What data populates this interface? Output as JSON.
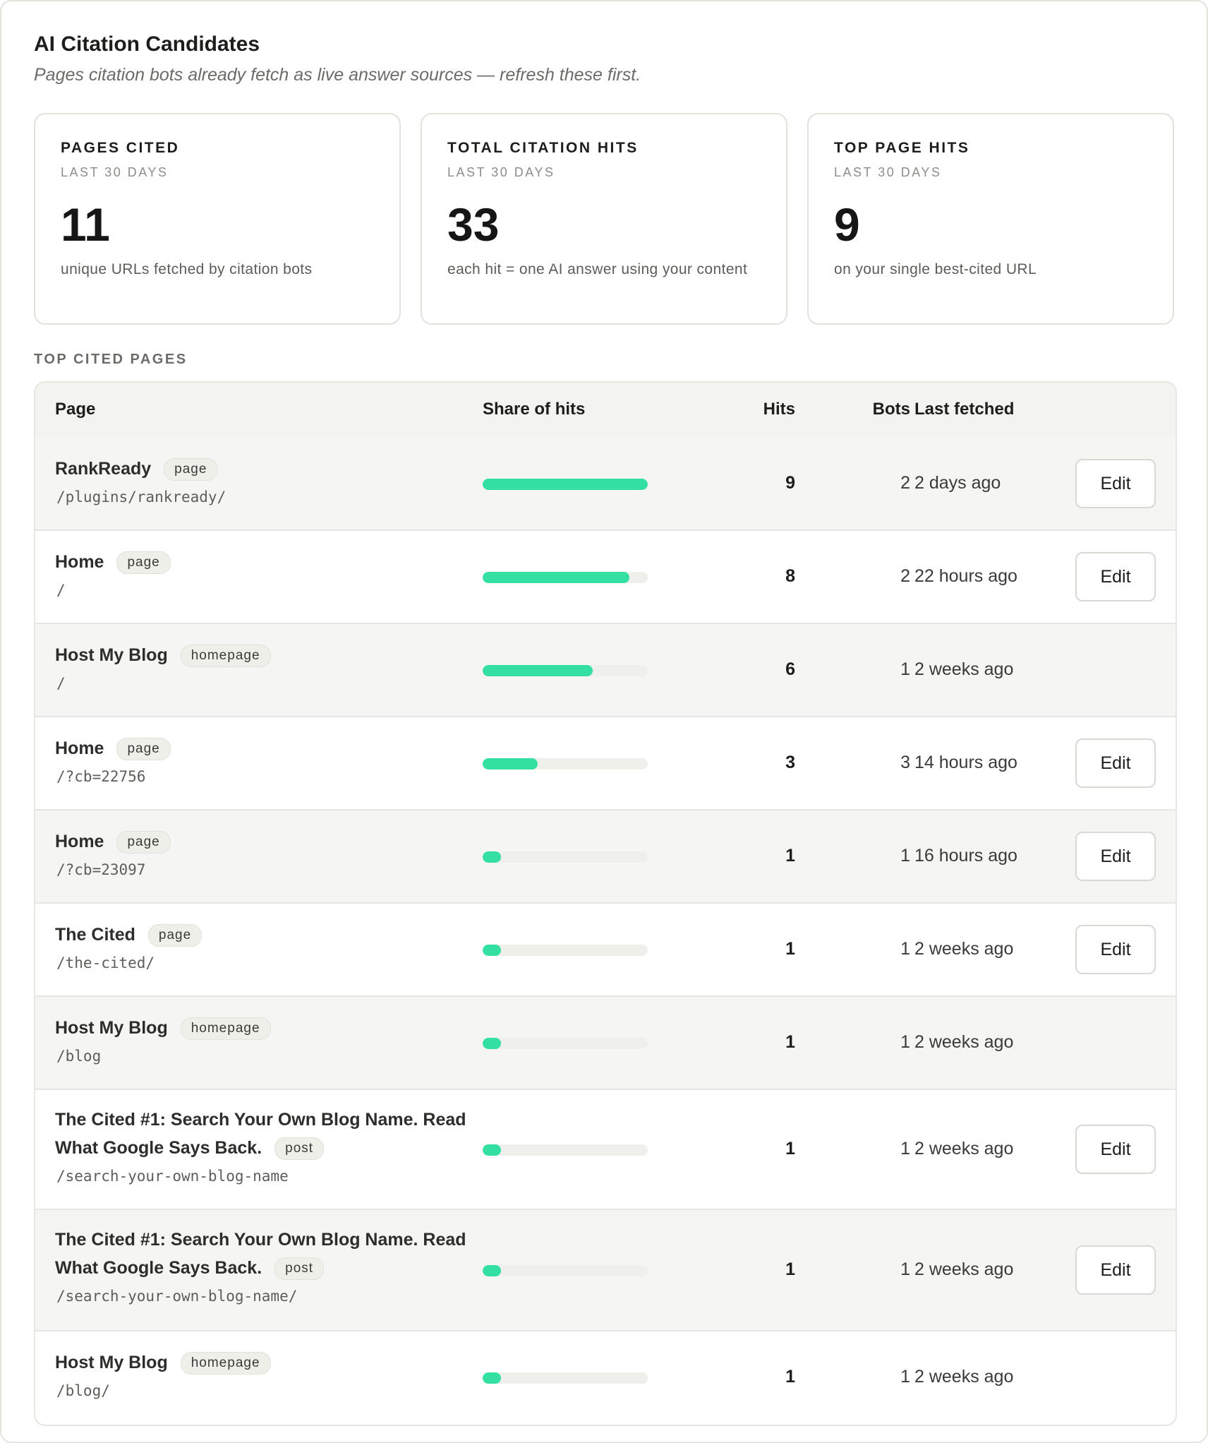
{
  "header": {
    "title": "AI Citation Candidates",
    "subtitle": "Pages citation bots already fetch as live answer sources — refresh these first."
  },
  "cards": [
    {
      "label": "PAGES CITED",
      "sub": "LAST 30 DAYS",
      "value": "11",
      "desc": "unique URLs fetched by citation bots"
    },
    {
      "label": "TOTAL CITATION HITS",
      "sub": "LAST 30 DAYS",
      "value": "33",
      "desc": "each hit = one AI answer using your content"
    },
    {
      "label": "TOP PAGE HITS",
      "sub": "LAST 30 DAYS",
      "value": "9",
      "desc": "on your single best-cited URL"
    }
  ],
  "section_label": "TOP CITED PAGES",
  "table": {
    "columns": {
      "page": "Page",
      "share": "Share of hits",
      "hits": "Hits",
      "bots": "Bots",
      "last_fetched": "Last fetched"
    },
    "edit_label": "Edit",
    "bar_color": "#34e0a1",
    "rows": [
      {
        "title": "RankReady",
        "type": "page",
        "path": "/plugins/rankready/",
        "share": 1.0,
        "hits": "9",
        "bots": "2",
        "last_fetched": "2 days ago",
        "editable": true
      },
      {
        "title": "Home",
        "type": "page",
        "path": "/",
        "share": 0.889,
        "hits": "8",
        "bots": "2",
        "last_fetched": "22 hours ago",
        "editable": true
      },
      {
        "title": "Host My Blog",
        "type": "homepage",
        "path": "/",
        "share": 0.667,
        "hits": "6",
        "bots": "1",
        "last_fetched": "2 weeks ago",
        "editable": false
      },
      {
        "title": "Home",
        "type": "page",
        "path": "/?cb=22756",
        "share": 0.333,
        "hits": "3",
        "bots": "3",
        "last_fetched": "14 hours ago",
        "editable": true
      },
      {
        "title": "Home",
        "type": "page",
        "path": "/?cb=23097",
        "share": 0.111,
        "hits": "1",
        "bots": "1",
        "last_fetched": "16 hours ago",
        "editable": true
      },
      {
        "title": "The Cited",
        "type": "page",
        "path": "/the-cited/",
        "share": 0.111,
        "hits": "1",
        "bots": "1",
        "last_fetched": "2 weeks ago",
        "editable": true
      },
      {
        "title": "Host My Blog",
        "type": "homepage",
        "path": "/blog",
        "share": 0.111,
        "hits": "1",
        "bots": "1",
        "last_fetched": "2 weeks ago",
        "editable": false
      },
      {
        "title": "The Cited #1: Search Your Own Blog Name. Read What Google Says Back.",
        "type": "post",
        "path": "/search-your-own-blog-name",
        "share": 0.111,
        "hits": "1",
        "bots": "1",
        "last_fetched": "2 weeks ago",
        "editable": true
      },
      {
        "title": "The Cited #1: Search Your Own Blog Name. Read What Google Says Back.",
        "type": "post",
        "path": "/search-your-own-blog-name/",
        "share": 0.111,
        "hits": "1",
        "bots": "1",
        "last_fetched": "2 weeks ago",
        "editable": true
      },
      {
        "title": "Host My Blog",
        "type": "homepage",
        "path": "/blog/",
        "share": 0.111,
        "hits": "1",
        "bots": "1",
        "last_fetched": "2 weeks ago",
        "editable": false
      }
    ]
  }
}
